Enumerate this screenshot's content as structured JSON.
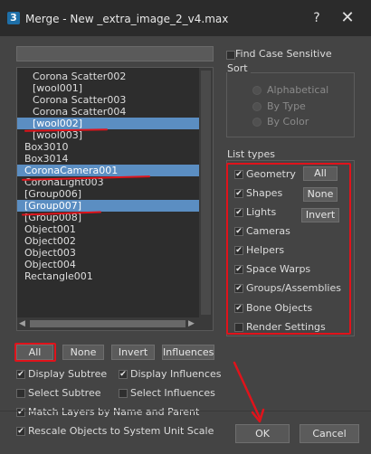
{
  "window": {
    "app_icon": "3",
    "title": "Merge - New _extra_image_2_v4.max",
    "help_icon": "?",
    "close_icon": "✕"
  },
  "list_items": [
    {
      "label": "Corona Scatter002",
      "selected": false
    },
    {
      "label": "[wool001]",
      "selected": false
    },
    {
      "label": "Corona Scatter003",
      "selected": false
    },
    {
      "label": "Corona Scatter004",
      "selected": false
    },
    {
      "label": "[wool002]",
      "selected": true
    },
    {
      "label": "[wool003]",
      "selected": false
    },
    {
      "label": "Box3010",
      "selected": false
    },
    {
      "label": "Box3014",
      "selected": false
    },
    {
      "label": "CoronaCamera001",
      "selected": true
    },
    {
      "label": "CoronaLight003",
      "selected": false
    },
    {
      "label": "[Group006]",
      "selected": false
    },
    {
      "label": "[Group007]",
      "selected": true
    },
    {
      "label": "[Group008]",
      "selected": false
    },
    {
      "label": "Object001",
      "selected": false
    },
    {
      "label": "Object002",
      "selected": false
    },
    {
      "label": "Object003",
      "selected": false
    },
    {
      "label": "Object004",
      "selected": false
    },
    {
      "label": "Rectangle001",
      "selected": false
    }
  ],
  "scroll": {
    "left_arrow": "◀",
    "right_arrow": "▶"
  },
  "list_buttons": {
    "all": "All",
    "none": "None",
    "invert": "Invert",
    "influences": "Influences"
  },
  "options": {
    "display_subtree": {
      "label": "Display Subtree",
      "checked": true
    },
    "display_influences": {
      "label": "Display Influences",
      "checked": true
    },
    "select_subtree": {
      "label": "Select Subtree",
      "checked": false
    },
    "select_influences": {
      "label": "Select Influences",
      "checked": false
    },
    "match_layers": {
      "label": "Match Layers by Name and Parent",
      "checked": true
    },
    "rescale": {
      "label": "Rescale Objects to System Unit Scale",
      "checked": true
    }
  },
  "find_case_sensitive": {
    "label": "Find Case Sensitive",
    "checked": false
  },
  "sort": {
    "title": "Sort",
    "alphabetical": "Alphabetical",
    "by_type": "By Type",
    "by_color": "By Color"
  },
  "list_types": {
    "title": "List types",
    "geometry": "Geometry",
    "shapes": "Shapes",
    "lights": "Lights",
    "cameras": "Cameras",
    "helpers": "Helpers",
    "space_warps": "Space Warps",
    "groups": "Groups/Assemblies",
    "bone_objects": "Bone Objects",
    "render_settings": "Render Settings",
    "all": "All",
    "none": "None",
    "invert": "Invert"
  },
  "dialog_buttons": {
    "ok": "OK",
    "cancel": "Cancel"
  },
  "check_glyph": "✔",
  "colors": {
    "accent_red": "#e0131b",
    "selection": "#5b8ec2"
  }
}
